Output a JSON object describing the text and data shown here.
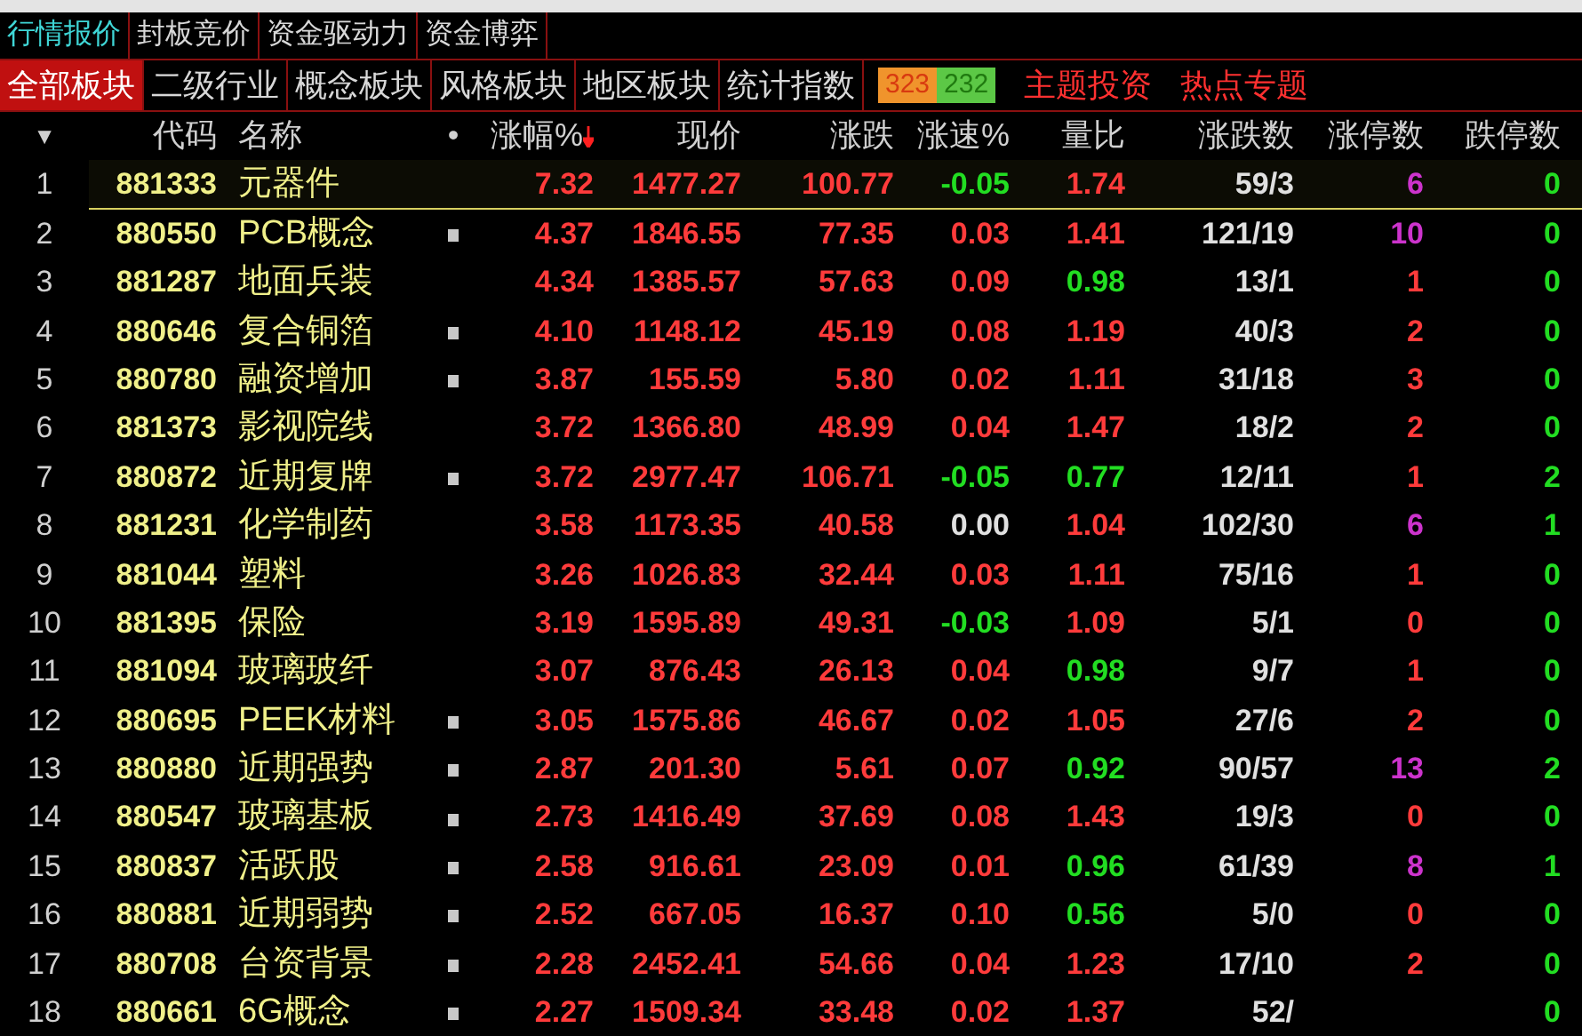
{
  "main_tabs": [
    {
      "label": "行情报价",
      "selected": true
    },
    {
      "label": "封板竞价",
      "selected": false
    },
    {
      "label": "资金驱动力",
      "selected": false
    },
    {
      "label": "资金博弈",
      "selected": false
    }
  ],
  "sector_tabs": [
    {
      "label": "全部板块",
      "selected": true
    },
    {
      "label": "二级行业",
      "selected": false
    },
    {
      "label": "概念板块",
      "selected": false
    },
    {
      "label": "风格板块",
      "selected": false
    },
    {
      "label": "地区板块",
      "selected": false
    },
    {
      "label": "统计指数",
      "selected": false
    }
  ],
  "breadth": {
    "up": "323",
    "down": "232"
  },
  "links": [
    "主题投资",
    "热点专题"
  ],
  "table": {
    "columns": [
      {
        "label": "▼",
        "sorted": false
      },
      {
        "label": "代码",
        "sorted": false
      },
      {
        "label": "名称",
        "sorted": false
      },
      {
        "label": "•",
        "sorted": false
      },
      {
        "label": "涨幅%",
        "sorted": true
      },
      {
        "label": "现价",
        "sorted": false
      },
      {
        "label": "涨跌",
        "sorted": false
      },
      {
        "label": "涨速%",
        "sorted": false
      },
      {
        "label": "量比",
        "sorted": false
      },
      {
        "label": "涨跌数",
        "sorted": false
      },
      {
        "label": "涨停数",
        "sorted": false
      },
      {
        "label": "跌停数",
        "sorted": false
      }
    ],
    "rows": [
      {
        "selected": true,
        "cells": [
          {
            "kind": "index",
            "text": "1"
          },
          {
            "kind": "code",
            "text": "881333"
          },
          {
            "kind": "name",
            "text": "元器件"
          },
          {
            "kind": "marker",
            "marked": false
          },
          {
            "kind": "value",
            "text": "7.32",
            "color": "#ff3b3b"
          },
          {
            "kind": "value",
            "text": "1477.27",
            "color": "#ff3b3b"
          },
          {
            "kind": "value",
            "text": "100.77",
            "color": "#ff3b3b"
          },
          {
            "kind": "value",
            "text": "-0.05",
            "color": "#22dd22"
          },
          {
            "kind": "value",
            "text": "1.74",
            "color": "#ff3b3b"
          },
          {
            "kind": "value",
            "text": "59/3",
            "color": "#e0e0e0"
          },
          {
            "kind": "value",
            "text": "6",
            "color": "#cc33cc"
          },
          {
            "kind": "value",
            "text": "0",
            "color": "#22dd22"
          }
        ]
      },
      {
        "selected": false,
        "cells": [
          {
            "kind": "index",
            "text": "2"
          },
          {
            "kind": "code",
            "text": "880550"
          },
          {
            "kind": "name",
            "text": "PCB概念"
          },
          {
            "kind": "marker",
            "marked": true
          },
          {
            "kind": "value",
            "text": "4.37",
            "color": "#ff3b3b"
          },
          {
            "kind": "value",
            "text": "1846.55",
            "color": "#ff3b3b"
          },
          {
            "kind": "value",
            "text": "77.35",
            "color": "#ff3b3b"
          },
          {
            "kind": "value",
            "text": "0.03",
            "color": "#ff3b3b"
          },
          {
            "kind": "value",
            "text": "1.41",
            "color": "#ff3b3b"
          },
          {
            "kind": "value",
            "text": "121/19",
            "color": "#e0e0e0"
          },
          {
            "kind": "value",
            "text": "10",
            "color": "#cc33cc"
          },
          {
            "kind": "value",
            "text": "0",
            "color": "#22dd22"
          }
        ]
      },
      {
        "selected": false,
        "cells": [
          {
            "kind": "index",
            "text": "3"
          },
          {
            "kind": "code",
            "text": "881287"
          },
          {
            "kind": "name",
            "text": "地面兵装"
          },
          {
            "kind": "marker",
            "marked": false
          },
          {
            "kind": "value",
            "text": "4.34",
            "color": "#ff3b3b"
          },
          {
            "kind": "value",
            "text": "1385.57",
            "color": "#ff3b3b"
          },
          {
            "kind": "value",
            "text": "57.63",
            "color": "#ff3b3b"
          },
          {
            "kind": "value",
            "text": "0.09",
            "color": "#ff3b3b"
          },
          {
            "kind": "value",
            "text": "0.98",
            "color": "#22dd22"
          },
          {
            "kind": "value",
            "text": "13/1",
            "color": "#e0e0e0"
          },
          {
            "kind": "value",
            "text": "1",
            "color": "#ff3b3b"
          },
          {
            "kind": "value",
            "text": "0",
            "color": "#22dd22"
          }
        ]
      },
      {
        "selected": false,
        "cells": [
          {
            "kind": "index",
            "text": "4"
          },
          {
            "kind": "code",
            "text": "880646"
          },
          {
            "kind": "name",
            "text": "复合铜箔"
          },
          {
            "kind": "marker",
            "marked": true
          },
          {
            "kind": "value",
            "text": "4.10",
            "color": "#ff3b3b"
          },
          {
            "kind": "value",
            "text": "1148.12",
            "color": "#ff3b3b"
          },
          {
            "kind": "value",
            "text": "45.19",
            "color": "#ff3b3b"
          },
          {
            "kind": "value",
            "text": "0.08",
            "color": "#ff3b3b"
          },
          {
            "kind": "value",
            "text": "1.19",
            "color": "#ff3b3b"
          },
          {
            "kind": "value",
            "text": "40/3",
            "color": "#e0e0e0"
          },
          {
            "kind": "value",
            "text": "2",
            "color": "#ff3b3b"
          },
          {
            "kind": "value",
            "text": "0",
            "color": "#22dd22"
          }
        ]
      },
      {
        "selected": false,
        "cells": [
          {
            "kind": "index",
            "text": "5"
          },
          {
            "kind": "code",
            "text": "880780"
          },
          {
            "kind": "name",
            "text": "融资增加"
          },
          {
            "kind": "marker",
            "marked": true
          },
          {
            "kind": "value",
            "text": "3.87",
            "color": "#ff3b3b"
          },
          {
            "kind": "value",
            "text": "155.59",
            "color": "#ff3b3b"
          },
          {
            "kind": "value",
            "text": "5.80",
            "color": "#ff3b3b"
          },
          {
            "kind": "value",
            "text": "0.02",
            "color": "#ff3b3b"
          },
          {
            "kind": "value",
            "text": "1.11",
            "color": "#ff3b3b"
          },
          {
            "kind": "value",
            "text": "31/18",
            "color": "#e0e0e0"
          },
          {
            "kind": "value",
            "text": "3",
            "color": "#ff3b3b"
          },
          {
            "kind": "value",
            "text": "0",
            "color": "#22dd22"
          }
        ]
      },
      {
        "selected": false,
        "cells": [
          {
            "kind": "index",
            "text": "6"
          },
          {
            "kind": "code",
            "text": "881373"
          },
          {
            "kind": "name",
            "text": "影视院线"
          },
          {
            "kind": "marker",
            "marked": false
          },
          {
            "kind": "value",
            "text": "3.72",
            "color": "#ff3b3b"
          },
          {
            "kind": "value",
            "text": "1366.80",
            "color": "#ff3b3b"
          },
          {
            "kind": "value",
            "text": "48.99",
            "color": "#ff3b3b"
          },
          {
            "kind": "value",
            "text": "0.04",
            "color": "#ff3b3b"
          },
          {
            "kind": "value",
            "text": "1.47",
            "color": "#ff3b3b"
          },
          {
            "kind": "value",
            "text": "18/2",
            "color": "#e0e0e0"
          },
          {
            "kind": "value",
            "text": "2",
            "color": "#ff3b3b"
          },
          {
            "kind": "value",
            "text": "0",
            "color": "#22dd22"
          }
        ]
      },
      {
        "selected": false,
        "cells": [
          {
            "kind": "index",
            "text": "7"
          },
          {
            "kind": "code",
            "text": "880872"
          },
          {
            "kind": "name",
            "text": "近期复牌"
          },
          {
            "kind": "marker",
            "marked": true
          },
          {
            "kind": "value",
            "text": "3.72",
            "color": "#ff3b3b"
          },
          {
            "kind": "value",
            "text": "2977.47",
            "color": "#ff3b3b"
          },
          {
            "kind": "value",
            "text": "106.71",
            "color": "#ff3b3b"
          },
          {
            "kind": "value",
            "text": "-0.05",
            "color": "#22dd22"
          },
          {
            "kind": "value",
            "text": "0.77",
            "color": "#22dd22"
          },
          {
            "kind": "value",
            "text": "12/11",
            "color": "#e0e0e0"
          },
          {
            "kind": "value",
            "text": "1",
            "color": "#ff3b3b"
          },
          {
            "kind": "value",
            "text": "2",
            "color": "#22dd22"
          }
        ]
      },
      {
        "selected": false,
        "cells": [
          {
            "kind": "index",
            "text": "8"
          },
          {
            "kind": "code",
            "text": "881231"
          },
          {
            "kind": "name",
            "text": "化学制药"
          },
          {
            "kind": "marker",
            "marked": false
          },
          {
            "kind": "value",
            "text": "3.58",
            "color": "#ff3b3b"
          },
          {
            "kind": "value",
            "text": "1173.35",
            "color": "#ff3b3b"
          },
          {
            "kind": "value",
            "text": "40.58",
            "color": "#ff3b3b"
          },
          {
            "kind": "value",
            "text": "0.00",
            "color": "#e0e0e0"
          },
          {
            "kind": "value",
            "text": "1.04",
            "color": "#ff3b3b"
          },
          {
            "kind": "value",
            "text": "102/30",
            "color": "#e0e0e0"
          },
          {
            "kind": "value",
            "text": "6",
            "color": "#cc33cc"
          },
          {
            "kind": "value",
            "text": "1",
            "color": "#22dd22"
          }
        ]
      },
      {
        "selected": false,
        "cells": [
          {
            "kind": "index",
            "text": "9"
          },
          {
            "kind": "code",
            "text": "881044"
          },
          {
            "kind": "name",
            "text": "塑料"
          },
          {
            "kind": "marker",
            "marked": false
          },
          {
            "kind": "value",
            "text": "3.26",
            "color": "#ff3b3b"
          },
          {
            "kind": "value",
            "text": "1026.83",
            "color": "#ff3b3b"
          },
          {
            "kind": "value",
            "text": "32.44",
            "color": "#ff3b3b"
          },
          {
            "kind": "value",
            "text": "0.03",
            "color": "#ff3b3b"
          },
          {
            "kind": "value",
            "text": "1.11",
            "color": "#ff3b3b"
          },
          {
            "kind": "value",
            "text": "75/16",
            "color": "#e0e0e0"
          },
          {
            "kind": "value",
            "text": "1",
            "color": "#ff3b3b"
          },
          {
            "kind": "value",
            "text": "0",
            "color": "#22dd22"
          }
        ]
      },
      {
        "selected": false,
        "cells": [
          {
            "kind": "index",
            "text": "10"
          },
          {
            "kind": "code",
            "text": "881395"
          },
          {
            "kind": "name",
            "text": "保险"
          },
          {
            "kind": "marker",
            "marked": false
          },
          {
            "kind": "value",
            "text": "3.19",
            "color": "#ff3b3b"
          },
          {
            "kind": "value",
            "text": "1595.89",
            "color": "#ff3b3b"
          },
          {
            "kind": "value",
            "text": "49.31",
            "color": "#ff3b3b"
          },
          {
            "kind": "value",
            "text": "-0.03",
            "color": "#22dd22"
          },
          {
            "kind": "value",
            "text": "1.09",
            "color": "#ff3b3b"
          },
          {
            "kind": "value",
            "text": "5/1",
            "color": "#e0e0e0"
          },
          {
            "kind": "value",
            "text": "0",
            "color": "#ff3b3b"
          },
          {
            "kind": "value",
            "text": "0",
            "color": "#22dd22"
          }
        ]
      },
      {
        "selected": false,
        "cells": [
          {
            "kind": "index",
            "text": "11"
          },
          {
            "kind": "code",
            "text": "881094"
          },
          {
            "kind": "name",
            "text": "玻璃玻纤"
          },
          {
            "kind": "marker",
            "marked": false
          },
          {
            "kind": "value",
            "text": "3.07",
            "color": "#ff3b3b"
          },
          {
            "kind": "value",
            "text": "876.43",
            "color": "#ff3b3b"
          },
          {
            "kind": "value",
            "text": "26.13",
            "color": "#ff3b3b"
          },
          {
            "kind": "value",
            "text": "0.04",
            "color": "#ff3b3b"
          },
          {
            "kind": "value",
            "text": "0.98",
            "color": "#22dd22"
          },
          {
            "kind": "value",
            "text": "9/7",
            "color": "#e0e0e0"
          },
          {
            "kind": "value",
            "text": "1",
            "color": "#ff3b3b"
          },
          {
            "kind": "value",
            "text": "0",
            "color": "#22dd22"
          }
        ]
      },
      {
        "selected": false,
        "cells": [
          {
            "kind": "index",
            "text": "12"
          },
          {
            "kind": "code",
            "text": "880695"
          },
          {
            "kind": "name",
            "text": "PEEK材料"
          },
          {
            "kind": "marker",
            "marked": true
          },
          {
            "kind": "value",
            "text": "3.05",
            "color": "#ff3b3b"
          },
          {
            "kind": "value",
            "text": "1575.86",
            "color": "#ff3b3b"
          },
          {
            "kind": "value",
            "text": "46.67",
            "color": "#ff3b3b"
          },
          {
            "kind": "value",
            "text": "0.02",
            "color": "#ff3b3b"
          },
          {
            "kind": "value",
            "text": "1.05",
            "color": "#ff3b3b"
          },
          {
            "kind": "value",
            "text": "27/6",
            "color": "#e0e0e0"
          },
          {
            "kind": "value",
            "text": "2",
            "color": "#ff3b3b"
          },
          {
            "kind": "value",
            "text": "0",
            "color": "#22dd22"
          }
        ]
      },
      {
        "selected": false,
        "cells": [
          {
            "kind": "index",
            "text": "13"
          },
          {
            "kind": "code",
            "text": "880880"
          },
          {
            "kind": "name",
            "text": "近期强势"
          },
          {
            "kind": "marker",
            "marked": true
          },
          {
            "kind": "value",
            "text": "2.87",
            "color": "#ff3b3b"
          },
          {
            "kind": "value",
            "text": "201.30",
            "color": "#ff3b3b"
          },
          {
            "kind": "value",
            "text": "5.61",
            "color": "#ff3b3b"
          },
          {
            "kind": "value",
            "text": "0.07",
            "color": "#ff3b3b"
          },
          {
            "kind": "value",
            "text": "0.92",
            "color": "#22dd22"
          },
          {
            "kind": "value",
            "text": "90/57",
            "color": "#e0e0e0"
          },
          {
            "kind": "value",
            "text": "13",
            "color": "#cc33cc"
          },
          {
            "kind": "value",
            "text": "2",
            "color": "#22dd22"
          }
        ]
      },
      {
        "selected": false,
        "cells": [
          {
            "kind": "index",
            "text": "14"
          },
          {
            "kind": "code",
            "text": "880547"
          },
          {
            "kind": "name",
            "text": "玻璃基板"
          },
          {
            "kind": "marker",
            "marked": true
          },
          {
            "kind": "value",
            "text": "2.73",
            "color": "#ff3b3b"
          },
          {
            "kind": "value",
            "text": "1416.49",
            "color": "#ff3b3b"
          },
          {
            "kind": "value",
            "text": "37.69",
            "color": "#ff3b3b"
          },
          {
            "kind": "value",
            "text": "0.08",
            "color": "#ff3b3b"
          },
          {
            "kind": "value",
            "text": "1.43",
            "color": "#ff3b3b"
          },
          {
            "kind": "value",
            "text": "19/3",
            "color": "#e0e0e0"
          },
          {
            "kind": "value",
            "text": "0",
            "color": "#ff3b3b"
          },
          {
            "kind": "value",
            "text": "0",
            "color": "#22dd22"
          }
        ]
      },
      {
        "selected": false,
        "cells": [
          {
            "kind": "index",
            "text": "15"
          },
          {
            "kind": "code",
            "text": "880837"
          },
          {
            "kind": "name",
            "text": "活跃股"
          },
          {
            "kind": "marker",
            "marked": true
          },
          {
            "kind": "value",
            "text": "2.58",
            "color": "#ff3b3b"
          },
          {
            "kind": "value",
            "text": "916.61",
            "color": "#ff3b3b"
          },
          {
            "kind": "value",
            "text": "23.09",
            "color": "#ff3b3b"
          },
          {
            "kind": "value",
            "text": "0.01",
            "color": "#ff3b3b"
          },
          {
            "kind": "value",
            "text": "0.96",
            "color": "#22dd22"
          },
          {
            "kind": "value",
            "text": "61/39",
            "color": "#e0e0e0"
          },
          {
            "kind": "value",
            "text": "8",
            "color": "#cc33cc"
          },
          {
            "kind": "value",
            "text": "1",
            "color": "#22dd22"
          }
        ]
      },
      {
        "selected": false,
        "cells": [
          {
            "kind": "index",
            "text": "16"
          },
          {
            "kind": "code",
            "text": "880881"
          },
          {
            "kind": "name",
            "text": "近期弱势"
          },
          {
            "kind": "marker",
            "marked": true
          },
          {
            "kind": "value",
            "text": "2.52",
            "color": "#ff3b3b"
          },
          {
            "kind": "value",
            "text": "667.05",
            "color": "#ff3b3b"
          },
          {
            "kind": "value",
            "text": "16.37",
            "color": "#ff3b3b"
          },
          {
            "kind": "value",
            "text": "0.10",
            "color": "#ff3b3b"
          },
          {
            "kind": "value",
            "text": "0.56",
            "color": "#22dd22"
          },
          {
            "kind": "value",
            "text": "5/0",
            "color": "#e0e0e0"
          },
          {
            "kind": "value",
            "text": "0",
            "color": "#ff3b3b"
          },
          {
            "kind": "value",
            "text": "0",
            "color": "#22dd22"
          }
        ]
      },
      {
        "selected": false,
        "cells": [
          {
            "kind": "index",
            "text": "17"
          },
          {
            "kind": "code",
            "text": "880708"
          },
          {
            "kind": "name",
            "text": "台资背景"
          },
          {
            "kind": "marker",
            "marked": true
          },
          {
            "kind": "value",
            "text": "2.28",
            "color": "#ff3b3b"
          },
          {
            "kind": "value",
            "text": "2452.41",
            "color": "#ff3b3b"
          },
          {
            "kind": "value",
            "text": "54.66",
            "color": "#ff3b3b"
          },
          {
            "kind": "value",
            "text": "0.04",
            "color": "#ff3b3b"
          },
          {
            "kind": "value",
            "text": "1.23",
            "color": "#ff3b3b"
          },
          {
            "kind": "value",
            "text": "17/10",
            "color": "#e0e0e0"
          },
          {
            "kind": "value",
            "text": "2",
            "color": "#ff3b3b"
          },
          {
            "kind": "value",
            "text": "0",
            "color": "#22dd22"
          }
        ]
      },
      {
        "selected": false,
        "cells": [
          {
            "kind": "index",
            "text": "18"
          },
          {
            "kind": "code",
            "text": "880661"
          },
          {
            "kind": "name",
            "text": "6G概念"
          },
          {
            "kind": "marker",
            "marked": true
          },
          {
            "kind": "value",
            "text": "2.27",
            "color": "#ff3b3b"
          },
          {
            "kind": "value",
            "text": "1509.34",
            "color": "#ff3b3b"
          },
          {
            "kind": "value",
            "text": "33.48",
            "color": "#ff3b3b"
          },
          {
            "kind": "value",
            "text": "0.02",
            "color": "#ff3b3b"
          },
          {
            "kind": "value",
            "text": "1.37",
            "color": "#ff3b3b"
          },
          {
            "kind": "value",
            "text": "52/",
            "color": "#e0e0e0"
          },
          null,
          {
            "kind": "value",
            "text": "0",
            "color": "#22dd22"
          }
        ]
      }
    ]
  }
}
